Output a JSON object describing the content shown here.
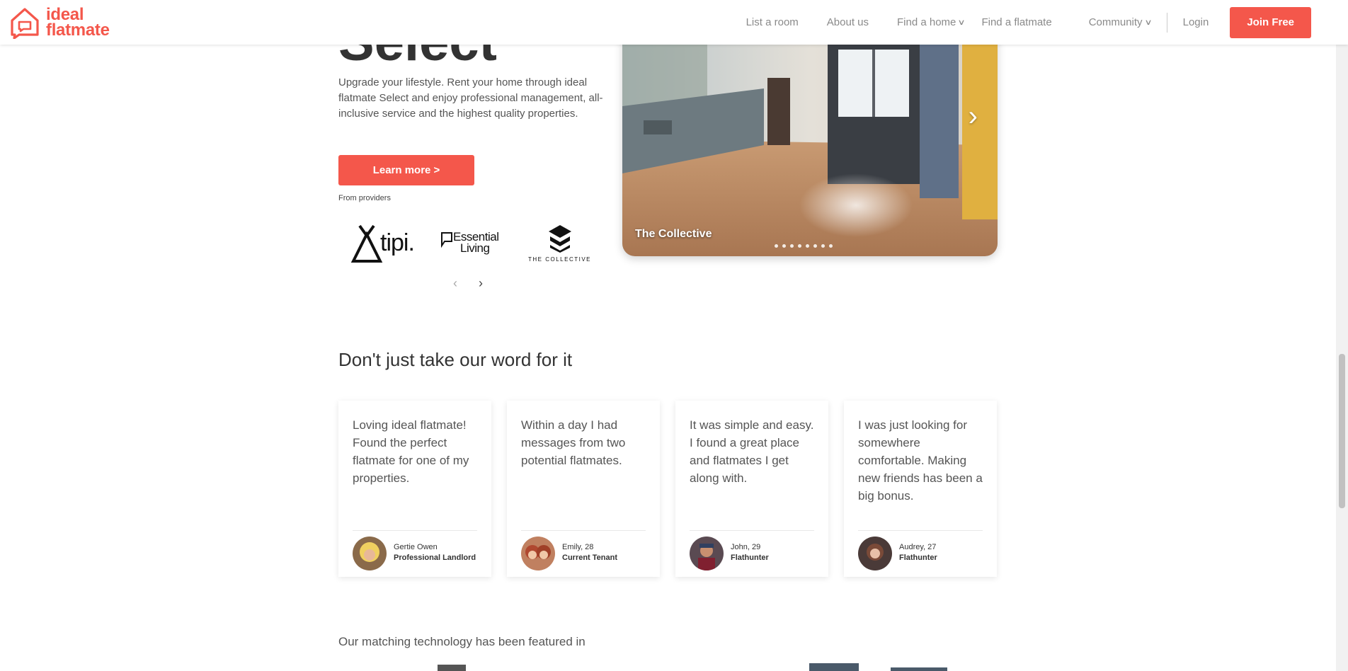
{
  "header": {
    "logo_text_line1": "ideal",
    "logo_text_line2": "flatmate",
    "nav": {
      "list_room": "List a room",
      "about": "About us",
      "find_home": "Find a home",
      "find_flatmate": "Find a flatmate",
      "community": "Community",
      "login": "Login",
      "join": "Join Free"
    }
  },
  "hero": {
    "title": "Select",
    "description": "Upgrade your lifestyle. Rent your home through ideal flatmate Select and enjoy professional management, all-inclusive service and the highest quality properties.",
    "cta": "Learn more >",
    "from_providers": "From providers",
    "providers": [
      "tipi.",
      "Essential Living",
      "THE COLLECTIVE"
    ],
    "provider_tipi": "tipi.",
    "provider_essential_1": "Essential",
    "provider_essential_2": "Living",
    "provider_collective": "THE COLLECTIVE",
    "prev_arrow": "‹",
    "next_arrow": "›"
  },
  "carousel": {
    "caption": "The Collective",
    "next_arrow": "›",
    "slide_count": 8
  },
  "testimonials": {
    "title": "Don't just take our word for it",
    "items": [
      {
        "quote": "Loving ideal flatmate! Found the perfect flatmate for one of my properties.",
        "name": "Gertie Owen",
        "role": "Professional Landlord"
      },
      {
        "quote": "Within a day I had messages from two potential flatmates.",
        "name": "Emily, 28",
        "role": "Current Tenant"
      },
      {
        "quote": "It was simple and easy. I found a great place and flatmates I get along with.",
        "name": "John, 29",
        "role": "Flathunter"
      },
      {
        "quote": "I was just looking for somewhere comfortable. Making new friends has been a big bonus.",
        "name": "Audrey, 27",
        "role": "Flathunter"
      }
    ]
  },
  "featured": {
    "title": "Our matching technology has been featured in"
  },
  "colors": {
    "brand": "#f4574b",
    "text": "#333333",
    "muted": "#8a8a8a"
  }
}
